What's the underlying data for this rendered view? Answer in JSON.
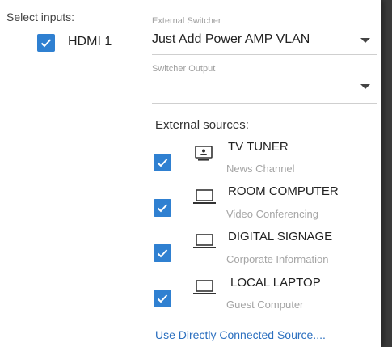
{
  "select_inputs_label": "Select inputs:",
  "hdmi": {
    "label": "HDMI 1",
    "checked": true
  },
  "external_switcher": {
    "label": "External Switcher",
    "value": "Just Add Power AMP VLAN"
  },
  "switcher_output": {
    "label": "Switcher Output",
    "value": ""
  },
  "external_sources_label": "External sources:",
  "sources": [
    {
      "name": "TV TUNER",
      "desc": "News Channel",
      "icon": "tv-tuner-icon",
      "checked": true
    },
    {
      "name": "ROOM COMPUTER",
      "desc": "Video Conferencing",
      "icon": "laptop-icon",
      "checked": true
    },
    {
      "name": "DIGITAL SIGNAGE",
      "desc": "Corporate Information",
      "icon": "laptop-icon",
      "checked": true
    },
    {
      "name": "LOCAL LAPTOP",
      "desc": "Guest Computer",
      "icon": "laptop-icon",
      "checked": true
    }
  ],
  "direct_link": "Use Directly Connected Source....",
  "colors": {
    "accent": "#2f80d1",
    "link": "#2b6fbf"
  }
}
